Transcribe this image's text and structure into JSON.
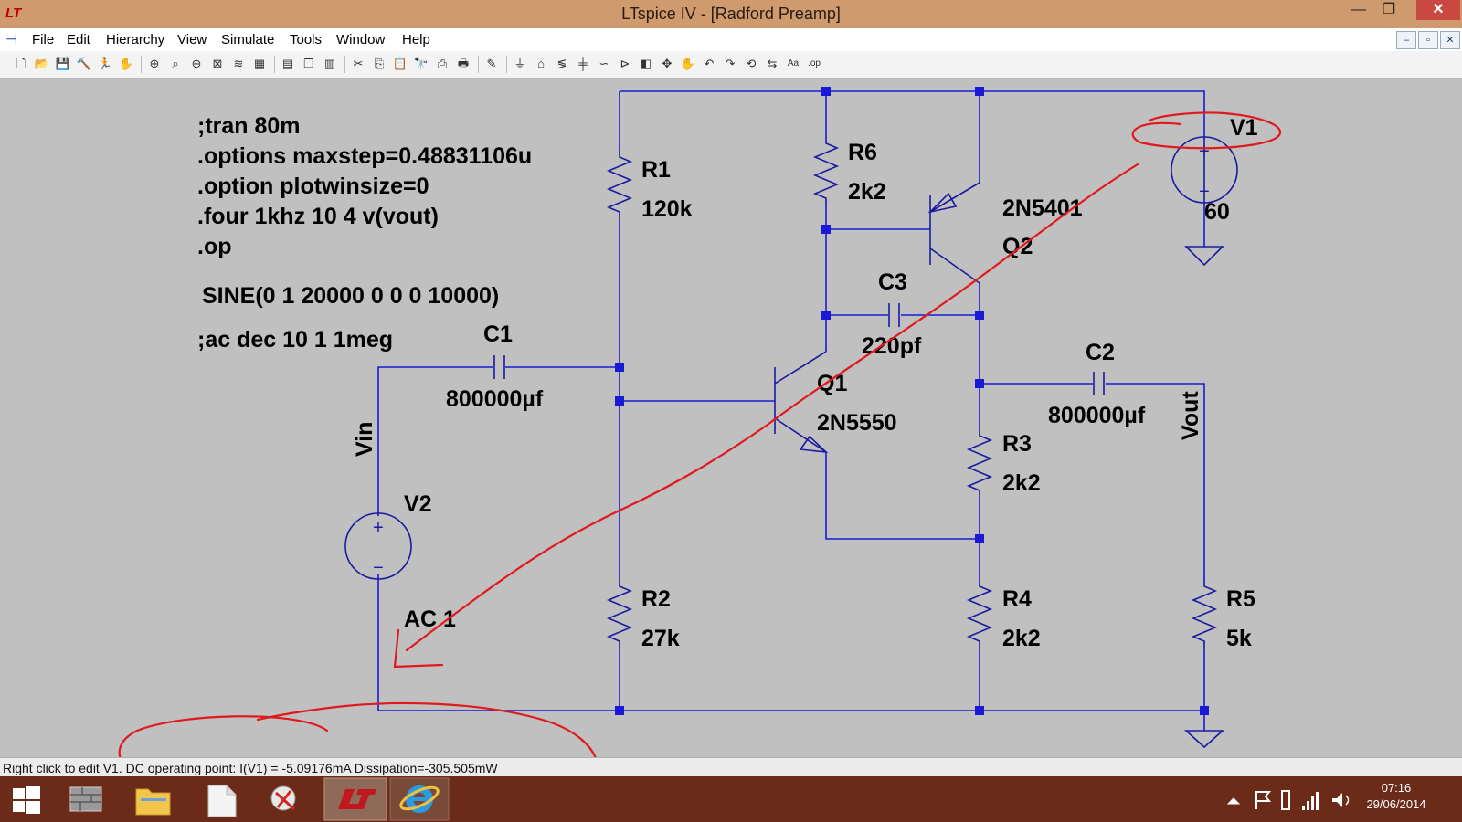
{
  "window": {
    "title": "LTspice IV - [Radford Preamp]",
    "app_icon": "LT",
    "min_glyph": "—",
    "max_glyph": "❐",
    "close_glyph": "✕"
  },
  "menu": {
    "items": [
      "File",
      "Edit",
      "Hierarchy",
      "View",
      "Simulate",
      "Tools",
      "Window",
      "Help"
    ],
    "mdi_buttons": [
      "–",
      "▫",
      "✕"
    ]
  },
  "toolbar_icons": [
    "new-schematic-icon",
    "open-icon",
    "save-icon",
    "control-panel-icon",
    "run-icon",
    "halt-icon",
    "zoom-in-icon",
    "zoom-pan-icon",
    "zoom-out-icon",
    "zoom-fit-icon",
    "autorange-icon",
    "grid-icon",
    "tile-horizontal-icon",
    "cascade-icon",
    "tile-vertical-icon",
    "cut-icon",
    "copy-icon",
    "paste-icon",
    "find-icon",
    "print-setup-icon",
    "print-icon",
    "wire-icon",
    "ground-icon",
    "label-net-icon",
    "resistor-icon",
    "capacitor-icon",
    "inductor-icon",
    "diode-icon",
    "component-icon",
    "move-icon",
    "drag-icon",
    "undo-icon",
    "redo-icon",
    "rotate-icon",
    "mirror-icon",
    "text-icon",
    "spice-directive-icon"
  ],
  "schematic": {
    "directives": [
      ";tran 80m",
      ".options maxstep=0.48831106u",
      ".option plotwinsize=0",
      ".four 1khz 10 4 v(vout)",
      ".op",
      "SINE(0 1 20000 0 0 0 10000)",
      ";ac dec 10 1 1meg"
    ],
    "components": {
      "r1": {
        "name": "R1",
        "value": "120k"
      },
      "r2": {
        "name": "R2",
        "value": "27k"
      },
      "r3": {
        "name": "R3",
        "value": "2k2"
      },
      "r4": {
        "name": "R4",
        "value": "2k2"
      },
      "r5": {
        "name": "R5",
        "value": "5k"
      },
      "r6": {
        "name": "R6",
        "value": "2k2"
      },
      "c1": {
        "name": "C1",
        "value": "800000µf"
      },
      "c2": {
        "name": "C2",
        "value": "800000µf"
      },
      "c3": {
        "name": "C3",
        "value": "220pf"
      },
      "q1": {
        "name": "Q1",
        "model": "2N5550"
      },
      "q2": {
        "name": "Q2",
        "model": "2N5401"
      },
      "v1": {
        "name": "V1",
        "value": "60"
      },
      "v2": {
        "name": "V2",
        "value": "AC 1"
      }
    },
    "net_labels": {
      "vin": "Vin",
      "vout": "Vout"
    },
    "plus_sign": "+",
    "minus_sign": "−"
  },
  "status": {
    "text": "Right click to edit V1.  DC operating point: I(V1) = -5.09176mA   Dissipation=-305.505mW"
  },
  "taskbar": {
    "time": "07:16",
    "date": "29/06/2014",
    "apps": [
      "start-icon",
      "file-manager-icon",
      "explorer-folder-icon",
      "document-icon",
      "snipping-tool-icon",
      "ltspice-taskbar-icon",
      "internet-explorer-icon"
    ]
  },
  "colors": {
    "wire": "#1a1ad6",
    "component": "#1a1aa0",
    "annotation": "#e0191d",
    "text": "#000000",
    "titlebar": "#cf9a6e",
    "taskbar": "#6b2b18"
  }
}
